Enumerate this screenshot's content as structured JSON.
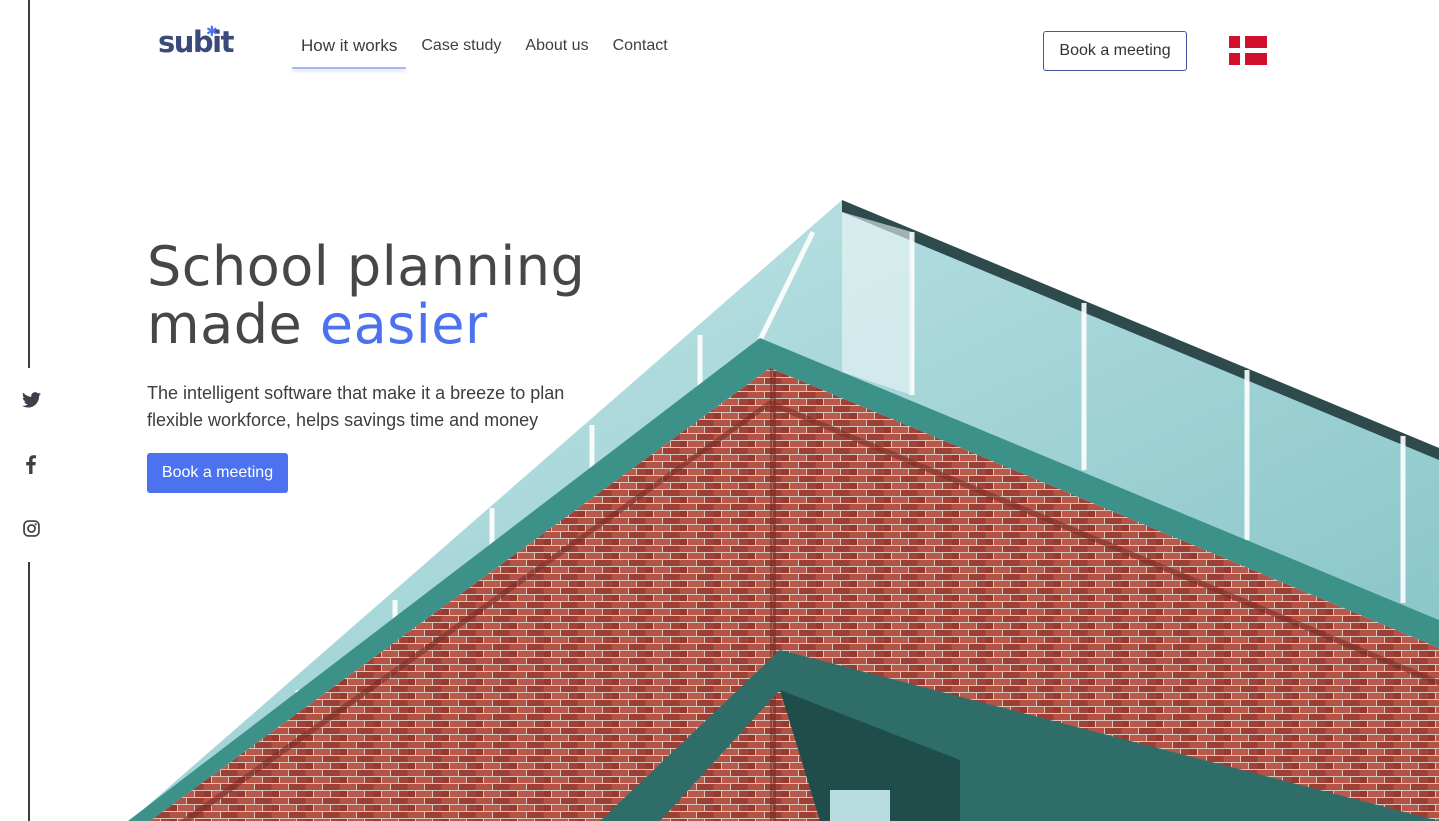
{
  "brand": {
    "logo_text": "subit"
  },
  "nav": {
    "items": [
      {
        "label": "How it works",
        "active": true
      },
      {
        "label": "Case study",
        "active": false
      },
      {
        "label": "About us",
        "active": false
      },
      {
        "label": "Contact",
        "active": false
      }
    ]
  },
  "header": {
    "meeting_button": "Book a meeting",
    "language_flag": "danish-flag"
  },
  "social": {
    "icons": [
      "twitter-icon",
      "facebook-icon",
      "instagram-icon"
    ]
  },
  "hero": {
    "headline_line1": "School planning",
    "headline_line2_prefix": "made ",
    "headline_line2_accent": "easier",
    "subtext": "The intelligent software that make it a breeze to plan flexible workforce, helps savings time and money",
    "cta_label": "Book a meeting"
  },
  "colors": {
    "accent": "#4d72f0",
    "brand_dark": "#3a4a7a",
    "flag_red": "#d0102c"
  }
}
